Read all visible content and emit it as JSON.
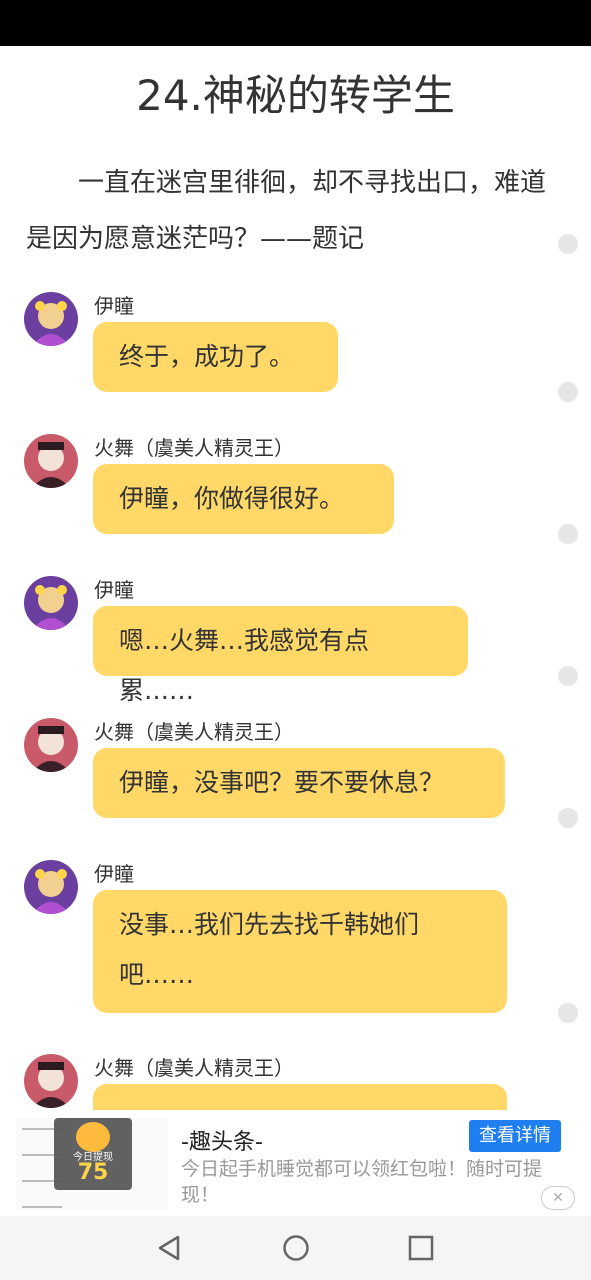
{
  "chapter_title": "24.神秘的转学生",
  "intro_text": "一直在迷宫里徘徊，却不寻找出口，难道是因为愿意迷茫吗？——题记",
  "messages": [
    {
      "speaker": "伊瞳",
      "text": "终于，成功了。"
    },
    {
      "speaker": "火舞（虞美人精灵王）",
      "text": "伊瞳，你做得很好。"
    },
    {
      "speaker": "伊瞳",
      "text": "嗯…火舞…我感觉有点累……"
    },
    {
      "speaker": "火舞（虞美人精灵王）",
      "text": "伊瞳，没事吧？要不要休息？"
    },
    {
      "speaker": "伊瞳",
      "text": "没事…我们先去找千韩她们吧……"
    },
    {
      "speaker": "火舞（虞美人精灵王）",
      "text": ""
    }
  ],
  "ad": {
    "title": "-趣头条-",
    "button": "查看详情",
    "description": "今日起手机睡觉都可以领红包啦！随时可提现！",
    "badge_label": "今日提现",
    "badge_value": "75",
    "close_icon": "close-icon"
  },
  "colors": {
    "bubble": "#ffd868",
    "ad_button": "#1f7ef0"
  },
  "navigation": {
    "back_icon": "back-triangle-icon",
    "home_icon": "home-circle-icon",
    "recent_icon": "recent-square-icon"
  }
}
